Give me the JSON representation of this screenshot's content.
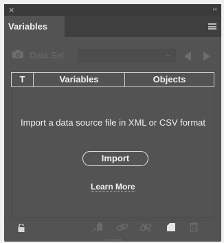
{
  "titlebar": {
    "close_glyph": "×",
    "collapse_glyph": "‹‹"
  },
  "tab": {
    "label": "Variables"
  },
  "dataset": {
    "label": "Data Set:",
    "value": ""
  },
  "columns": {
    "t": "T",
    "variables": "Variables",
    "objects": "Objects"
  },
  "empty_message": "Import a data source file in XML or CSV format",
  "import_label": "Import",
  "learn_more_label": "Learn More",
  "colors": {
    "panel_bg": "#535353",
    "titlebar_bg": "#3b3b3b",
    "text": "#f0f0f0",
    "disabled": "#6d6d6d"
  },
  "icons": [
    "close-icon",
    "collapse-icon",
    "panel-menu-icon",
    "camera-icon",
    "chevron-down-icon",
    "prev-arrow-icon",
    "next-arrow-icon",
    "lock-icon",
    "bind-icon",
    "link-icon",
    "unlink-icon",
    "new-icon",
    "trash-icon"
  ]
}
